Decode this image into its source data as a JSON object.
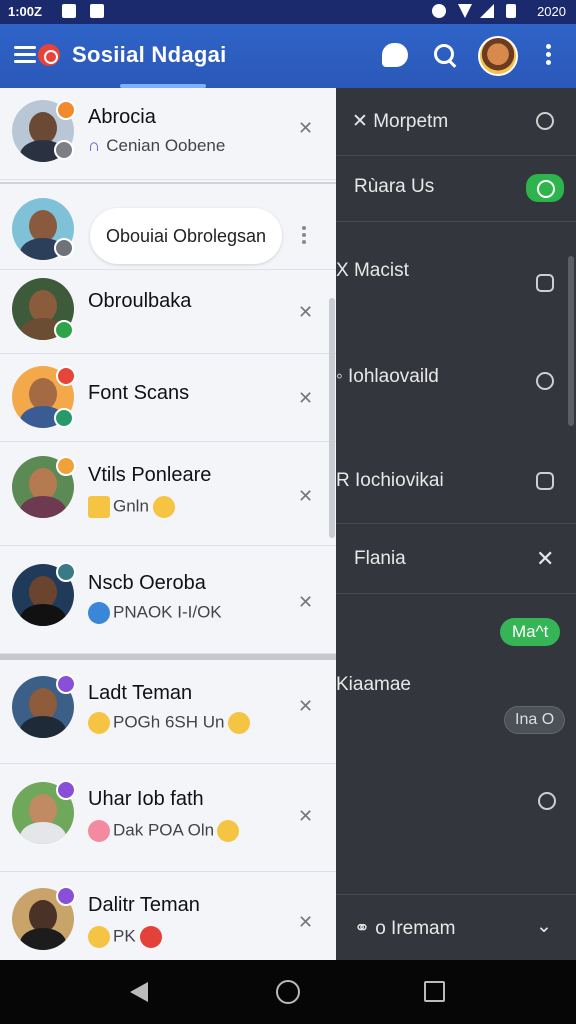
{
  "status_bar": {
    "time": "1:00Z",
    "right_time": "2020"
  },
  "app_bar": {
    "title": "Sosiial Ndagai"
  },
  "contacts": [
    {
      "name": "Abrocia",
      "subtitle": "Cenian Oobene"
    },
    {
      "name": "",
      "bubble": "Obouiai Obrolegsan"
    },
    {
      "name": "Obroulbaka",
      "subtitle": ""
    },
    {
      "name": "Font Scans",
      "subtitle": ""
    },
    {
      "name": "Vtils Ponleare",
      "subtitle": "Gnln"
    },
    {
      "name": "Nscb Oeroba",
      "subtitle": "PNAOK  I-I/OK"
    },
    {
      "name": "Ladt Teman",
      "subtitle": "POGh  6SH  Un"
    },
    {
      "name": "Uhar Iob fath",
      "subtitle": "Dak  POA  Oln"
    },
    {
      "name": "Dalitr Teman",
      "subtitle": "PK"
    }
  ],
  "panel": {
    "items": [
      {
        "label": "Morpetm"
      },
      {
        "label": "Rùara Us"
      },
      {
        "label": "Macist"
      },
      {
        "label": "Iohlaovaild"
      },
      {
        "label": "Iochiovikai"
      },
      {
        "label": "Flania"
      },
      {
        "label": "Ma^t",
        "chip": true
      },
      {
        "label": "Kiaamae"
      },
      {
        "label": "Ina O",
        "chip": true
      },
      {
        "label": "o Iremam"
      }
    ]
  },
  "icons": {
    "menu": "menu-icon",
    "chat": "chat-icon",
    "search": "search-icon",
    "overflow": "overflow-icon",
    "close": "close-icon",
    "back": "back-icon",
    "home": "home-icon",
    "recent": "recent-apps-icon"
  },
  "colors": {
    "app_bar": "#2f64c8",
    "panel": "#33363c",
    "accent_green": "#2eb44c"
  }
}
